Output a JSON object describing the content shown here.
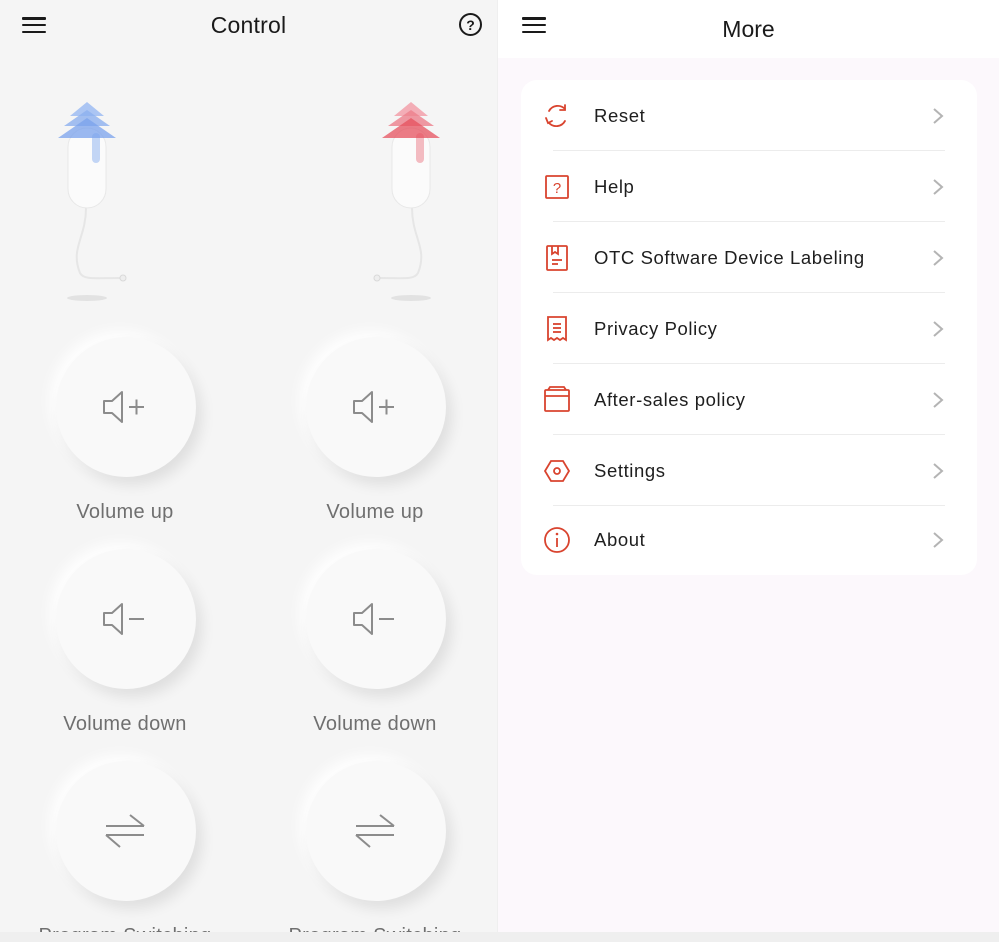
{
  "colors": {
    "accent": "#d9442f",
    "left_bg": "#f5f5f5",
    "right_bg": "#fcf8fc",
    "icon_gray": "#8c8c8c",
    "left_device_tip": "#5b8fe8",
    "right_device_tip": "#e5505e"
  },
  "control_screen": {
    "title": "Control",
    "menu_icon": "hamburger-menu-icon",
    "help_icon": "help-circle-icon",
    "help_glyph": "?",
    "devices": [
      {
        "side": "left",
        "tip_color": "blue"
      },
      {
        "side": "right",
        "tip_color": "red"
      }
    ],
    "controls": {
      "left": [
        {
          "icon": "volume-up-icon",
          "label": "Volume up"
        },
        {
          "icon": "volume-down-icon",
          "label": "Volume down"
        },
        {
          "icon": "swap-arrows-icon",
          "label": "Program Switching"
        }
      ],
      "right": [
        {
          "icon": "volume-up-icon",
          "label": "Volume up"
        },
        {
          "icon": "volume-down-icon",
          "label": "Volume down"
        },
        {
          "icon": "swap-arrows-icon",
          "label": "Program Switching"
        }
      ]
    }
  },
  "more_screen": {
    "title": "More",
    "menu_icon": "hamburger-menu-icon",
    "items": [
      {
        "icon": "reset-icon",
        "label": "Reset"
      },
      {
        "icon": "help-square-icon",
        "label": "Help"
      },
      {
        "icon": "bookmark-document-icon",
        "label": "OTC Software Device Labeling"
      },
      {
        "icon": "receipt-icon",
        "label": "Privacy Policy"
      },
      {
        "icon": "box-icon",
        "label": "After-sales policy"
      },
      {
        "icon": "hexagon-settings-icon",
        "label": "Settings"
      },
      {
        "icon": "info-circle-icon",
        "label": "About"
      }
    ]
  }
}
